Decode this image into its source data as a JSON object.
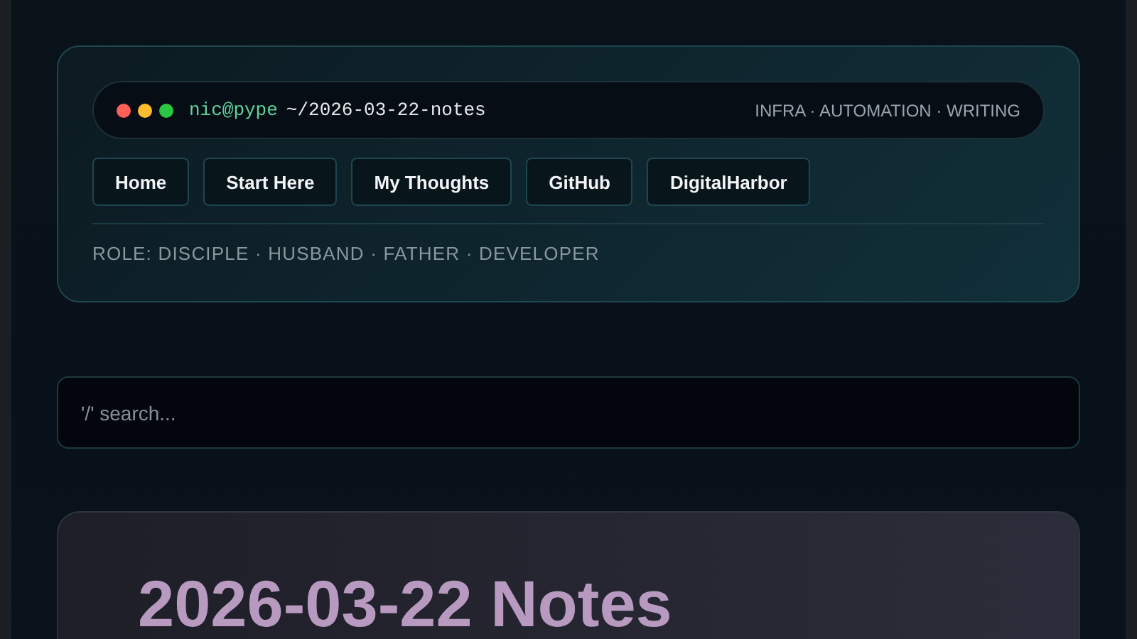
{
  "terminal": {
    "user": "nic@pype",
    "path": "~/2026-03-22-notes",
    "tags": "INFRA · AUTOMATION · WRITING"
  },
  "nav": [
    "Home",
    "Start Here",
    "My Thoughts",
    "GitHub",
    "DigitalHarbor"
  ],
  "role": "ROLE: DISCIPLE · HUSBAND · FATHER · DEVELOPER",
  "search": {
    "placeholder": "'/' search..."
  },
  "post": {
    "title": "2026-03-22 Notes"
  }
}
